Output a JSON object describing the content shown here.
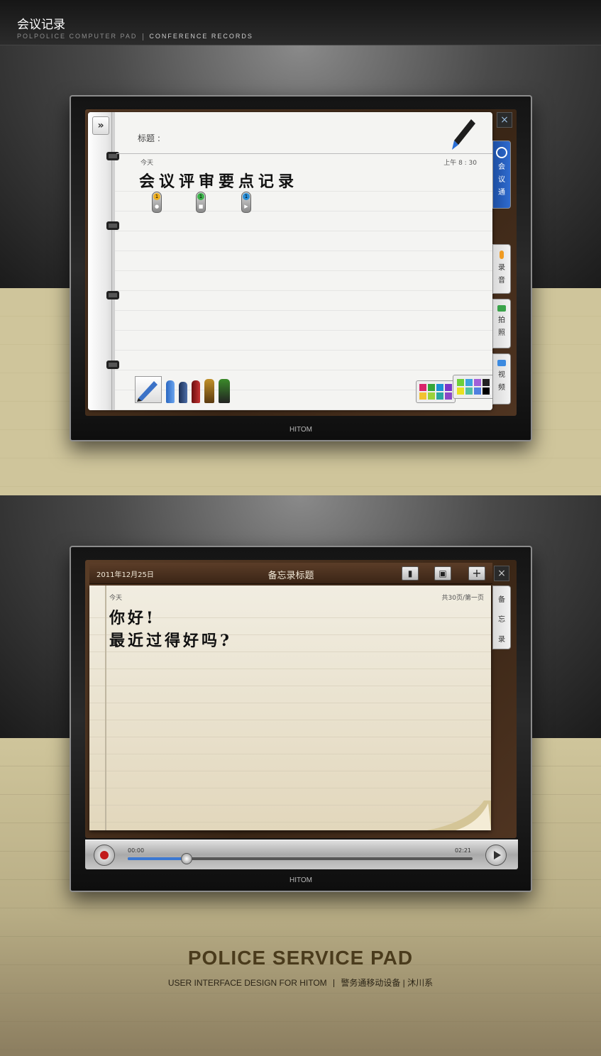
{
  "header": {
    "title": "会议记录",
    "subtitle_left": "POLPOLICE COMPUTER PAD",
    "subtitle_right": "CONFERENCE  RECORDS"
  },
  "device1": {
    "brand": "HITOM",
    "title_label": "标题 :",
    "date_label": "今天",
    "time": "上午 8 : 30",
    "handwriting": "会议评审要点记录",
    "pin_number": "1",
    "tabs": [
      {
        "label": "会议通",
        "chars": [
          "会",
          "议",
          "通"
        ],
        "active": true
      },
      {
        "label": "录音",
        "chars": [
          "录",
          "音"
        ],
        "active": false
      },
      {
        "label": "拍照",
        "chars": [
          "拍",
          "照"
        ],
        "active": false
      },
      {
        "label": "视频",
        "chars": [
          "视",
          "频"
        ],
        "active": false
      }
    ],
    "collapse_glyph": "»",
    "close_glyph": "×",
    "palette_colors": [
      "#d9246a",
      "#35a63a",
      "#1b8fd6",
      "#7a35c9",
      "#f2c230",
      "#9bd23a",
      "#2aa5a0",
      "#8a47c7"
    ],
    "palette2_colors": [
      "#6dcf3a",
      "#3ca0e0",
      "#a060d8",
      "#222222",
      "#e8e020",
      "#50c0a0",
      "#5080e0",
      "#000000"
    ]
  },
  "device2": {
    "brand": "HITOM",
    "date": "2011年12月25日",
    "title": "备忘录标题",
    "date_label": "今天",
    "page_info": "共30页/第一页",
    "handwriting_line1": "你好!",
    "handwriting_line2": "最近过得好吗?",
    "tab_chars": [
      "备",
      "忘",
      "录"
    ],
    "close_glyph": "×",
    "time_start": "00:00",
    "time_end": "02:21",
    "progress": 0.17
  },
  "footer": {
    "title": "POLICE SERVICE PAD",
    "subtitle": "USER INTERFACE DESIGN FOR HITOM",
    "subtitle_cn": "警务通移动设备 | 沐川系"
  }
}
